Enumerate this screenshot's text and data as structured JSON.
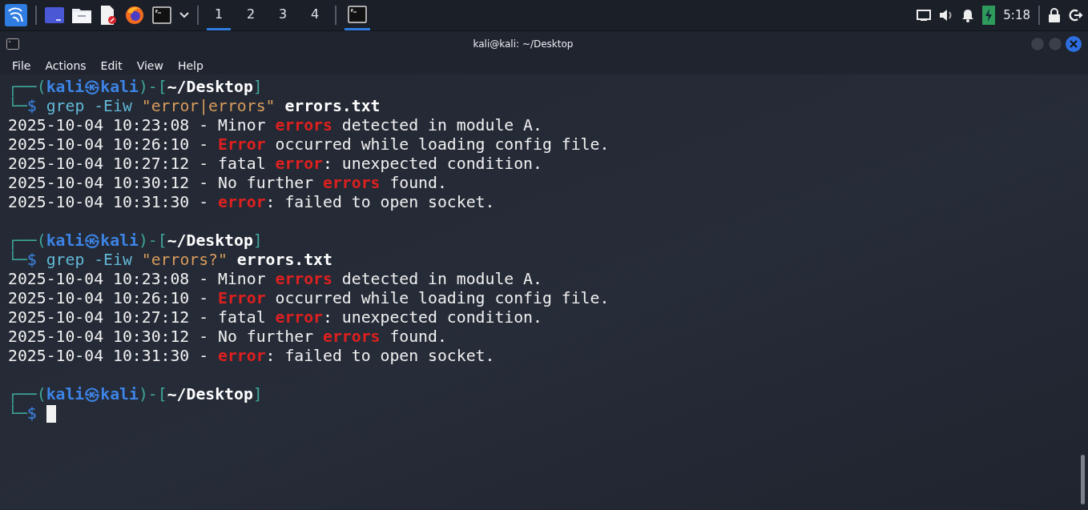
{
  "taskbar": {
    "workspaces": [
      {
        "label": "1",
        "selected": true
      },
      {
        "label": "2",
        "selected": false
      },
      {
        "label": "3",
        "selected": false
      },
      {
        "label": "4",
        "selected": false
      }
    ],
    "tasks": [
      {
        "selected": true
      }
    ],
    "clock": "5:18"
  },
  "window": {
    "title": "kali@kali: ~/Desktop",
    "menu": [
      "File",
      "Actions",
      "Edit",
      "View",
      "Help"
    ]
  },
  "terminal": {
    "lines": [
      [
        {
          "kind": "frame",
          "text": "┌──("
        },
        {
          "kind": "user",
          "text": "kali㉿kali"
        },
        {
          "kind": "frame",
          "text": ")-["
        },
        {
          "kind": "path",
          "text": "~/Desktop"
        },
        {
          "kind": "frame",
          "text": "]"
        }
      ],
      [
        {
          "kind": "frame",
          "text": "└─"
        },
        {
          "kind": "sigil",
          "text": "$ "
        },
        {
          "kind": "cmd",
          "text": "grep -Eiw "
        },
        {
          "kind": "pattern",
          "text": "\"error|errors\""
        },
        {
          "kind": "file",
          "text": " errors.txt"
        }
      ],
      [
        {
          "kind": "plain",
          "text": "2025-10-04 10:23:08 - Minor "
        },
        {
          "kind": "match",
          "text": "errors"
        },
        {
          "kind": "plain",
          "text": " detected in module A."
        }
      ],
      [
        {
          "kind": "plain",
          "text": "2025-10-04 10:26:10 - "
        },
        {
          "kind": "match",
          "text": "Error"
        },
        {
          "kind": "plain",
          "text": " occurred while loading config file."
        }
      ],
      [
        {
          "kind": "plain",
          "text": "2025-10-04 10:27:12 - fatal "
        },
        {
          "kind": "match",
          "text": "error"
        },
        {
          "kind": "plain",
          "text": ": unexpected condition."
        }
      ],
      [
        {
          "kind": "plain",
          "text": "2025-10-04 10:30:12 - No further "
        },
        {
          "kind": "match",
          "text": "errors"
        },
        {
          "kind": "plain",
          "text": " found."
        }
      ],
      [
        {
          "kind": "plain",
          "text": "2025-10-04 10:31:30 - "
        },
        {
          "kind": "match",
          "text": "error"
        },
        {
          "kind": "plain",
          "text": ": failed to open socket."
        }
      ],
      [
        {
          "kind": "blank"
        }
      ],
      [
        {
          "kind": "frame",
          "text": "┌──("
        },
        {
          "kind": "user",
          "text": "kali㉿kali"
        },
        {
          "kind": "frame",
          "text": ")-["
        },
        {
          "kind": "path",
          "text": "~/Desktop"
        },
        {
          "kind": "frame",
          "text": "]"
        }
      ],
      [
        {
          "kind": "frame",
          "text": "└─"
        },
        {
          "kind": "sigil",
          "text": "$ "
        },
        {
          "kind": "cmd",
          "text": "grep -Eiw "
        },
        {
          "kind": "pattern",
          "text": "\"errors?\""
        },
        {
          "kind": "file",
          "text": " errors.txt"
        }
      ],
      [
        {
          "kind": "plain",
          "text": "2025-10-04 10:23:08 - Minor "
        },
        {
          "kind": "match",
          "text": "errors"
        },
        {
          "kind": "plain",
          "text": " detected in module A."
        }
      ],
      [
        {
          "kind": "plain",
          "text": "2025-10-04 10:26:10 - "
        },
        {
          "kind": "match",
          "text": "Error"
        },
        {
          "kind": "plain",
          "text": " occurred while loading config file."
        }
      ],
      [
        {
          "kind": "plain",
          "text": "2025-10-04 10:27:12 - fatal "
        },
        {
          "kind": "match",
          "text": "error"
        },
        {
          "kind": "plain",
          "text": ": unexpected condition."
        }
      ],
      [
        {
          "kind": "plain",
          "text": "2025-10-04 10:30:12 - No further "
        },
        {
          "kind": "match",
          "text": "errors"
        },
        {
          "kind": "plain",
          "text": " found."
        }
      ],
      [
        {
          "kind": "plain",
          "text": "2025-10-04 10:31:30 - "
        },
        {
          "kind": "match",
          "text": "error"
        },
        {
          "kind": "plain",
          "text": ": failed to open socket."
        }
      ],
      [
        {
          "kind": "blank"
        }
      ],
      [
        {
          "kind": "frame",
          "text": "┌──("
        },
        {
          "kind": "user",
          "text": "kali㉿kali"
        },
        {
          "kind": "frame",
          "text": ")-["
        },
        {
          "kind": "path",
          "text": "~/Desktop"
        },
        {
          "kind": "frame",
          "text": "]"
        }
      ],
      [
        {
          "kind": "frame",
          "text": "└─"
        },
        {
          "kind": "sigil",
          "text": "$ "
        },
        {
          "kind": "cursor"
        }
      ]
    ]
  }
}
